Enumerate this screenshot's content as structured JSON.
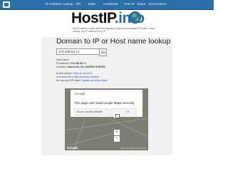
{
  "nav": {
    "items": [
      "IP Address Lookup",
      "API",
      "Data",
      "Contribute",
      "Free IP",
      "About",
      "Ecommerce"
    ]
  },
  "brand": {
    "name_part1": "HostIP",
    "name_part2": ".info",
    "tagline": "My IP Address Lookup and GeoTargeting Community Geotarget IP Project – what country, city, IP address is my IP"
  },
  "page": {
    "title": "Domain to IP or Host name lookup"
  },
  "search": {
    "value": "173.245.54.71",
    "button_label": "Go"
  },
  "result": {
    "host_name_label": "Host name:",
    "ip_label": "IP address:",
    "ip_value": "173.245.54.71",
    "location_label": "Location:",
    "location_value": "Somerset, NJ, UNITED STATES"
  },
  "prompts": {
    "wrong_prefix": "Is this wrong?",
    "wrong_link": "Help us correct it",
    "download_prefix": "or",
    "download_link": "Download a High Accuracy Version",
    "isp_prefix": "Are you an ISP Host?",
    "isp_link": "Update an entire block"
  },
  "map": {
    "dialog_brand": "Google",
    "dialog_message": "This page can't load Google Maps correctly.",
    "dialog_question": "Do you own this website?",
    "dialog_ok": "OK",
    "watermark": "Google",
    "footer": "Map data ©2022  Terms of Use",
    "zoom_in": "+",
    "zoom_out": "−"
  },
  "colors": {
    "nav_bg": "#2a6fa8",
    "brand_blue": "#1f6fb5",
    "link": "#1a56c9",
    "content_bg": "#f1f1f1",
    "map_bg": "#7c7d73"
  }
}
